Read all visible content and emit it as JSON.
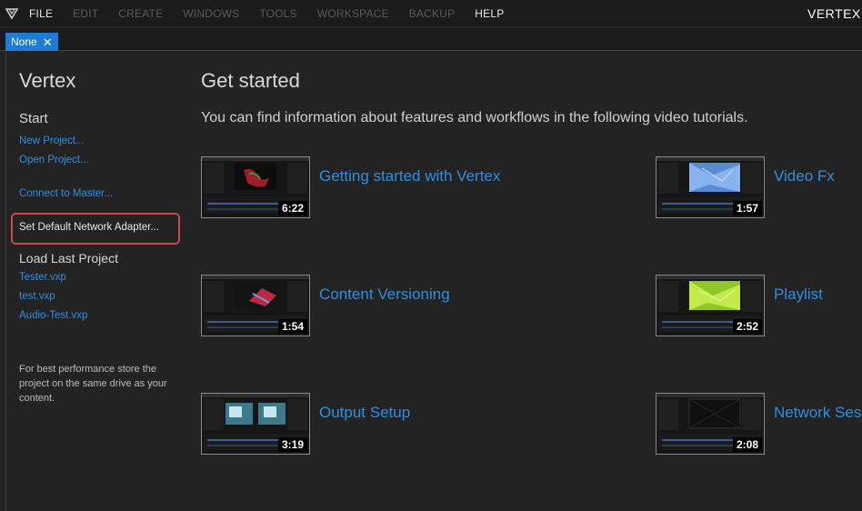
{
  "menu": {
    "items": [
      {
        "label": "FILE",
        "enabled": true
      },
      {
        "label": "EDIT",
        "enabled": false
      },
      {
        "label": "CREATE",
        "enabled": false
      },
      {
        "label": "WINDOWS",
        "enabled": false
      },
      {
        "label": "TOOLS",
        "enabled": false
      },
      {
        "label": "WORKSPACE",
        "enabled": false
      },
      {
        "label": "BACKUP",
        "enabled": false
      },
      {
        "label": "HELP",
        "enabled": true
      }
    ],
    "app_title": "VERTEX S"
  },
  "tab": {
    "label": "None",
    "close_symbol": "✕"
  },
  "sidebar": {
    "title": "Vertex",
    "start_heading": "Start",
    "new_project": "New Project...",
    "open_project": "Open Project...",
    "connect_master": "Connect to Master...",
    "set_network_adapter": "Set Default Network Adapter...",
    "load_last_heading": "Load Last Project",
    "recent": [
      "Tester.vxp",
      "test.vxp",
      "Audio-Test.vxp"
    ],
    "tip": "For best performance store the project on the same drive as your content."
  },
  "main": {
    "title": "Get started",
    "subtitle": "You can find information about features and workflows in the following video tutorials.",
    "tutorials": [
      {
        "label": "Getting started with Vertex",
        "duration": "6:22",
        "preview": "red-leaves"
      },
      {
        "label": "Video Fx",
        "duration": "1:57",
        "preview": "blue-facets"
      },
      {
        "label": "Content Versioning",
        "duration": "1:54",
        "preview": "red-streaks"
      },
      {
        "label": "Playlist",
        "duration": "2:52",
        "preview": "lime-facets"
      },
      {
        "label": "Output Setup",
        "duration": "3:19",
        "preview": "teal-split"
      },
      {
        "label": "Network Sess",
        "duration": "2:08",
        "preview": "dark-grid"
      }
    ]
  },
  "colors": {
    "accent": "#1e7cd6",
    "link": "#2f8fe0",
    "highlight": "#c94a4a"
  }
}
